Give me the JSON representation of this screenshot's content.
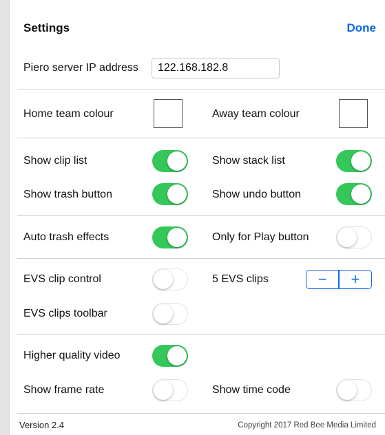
{
  "header": {
    "title": "Settings",
    "done_label": "Done"
  },
  "server": {
    "label": "Piero server IP address",
    "ip_value": "122.168.182.8"
  },
  "colours": {
    "home_label": "Home team colour",
    "away_label": "Away team colour",
    "home_colour": "#ffffff",
    "away_colour": "#ffffff"
  },
  "toggles": {
    "show_clip_list": {
      "label": "Show clip list",
      "on": true
    },
    "show_stack_list": {
      "label": "Show stack list",
      "on": true
    },
    "show_trash_button": {
      "label": "Show trash button",
      "on": true
    },
    "show_undo_button": {
      "label": "Show undo button",
      "on": true
    },
    "auto_trash_effects": {
      "label": "Auto trash effects",
      "on": true
    },
    "only_for_play_button": {
      "label": "Only for Play button",
      "on": false
    },
    "evs_clip_control": {
      "label": "EVS clip control",
      "on": false
    },
    "evs_clips_toolbar": {
      "label": "EVS clips toolbar",
      "on": false
    },
    "higher_quality_video": {
      "label": "Higher quality video",
      "on": true
    },
    "show_frame_rate": {
      "label": "Show frame rate",
      "on": false
    },
    "show_time_code": {
      "label": "Show time code",
      "on": false
    }
  },
  "evs": {
    "clips_label": "5 EVS clips",
    "minus_glyph": "−",
    "plus_glyph": "+"
  },
  "footer": {
    "version": "Version 2.4",
    "copyright": "Copyright 2017 Red Bee Media Limited"
  },
  "colors": {
    "accent": "#0a6be0",
    "toggle_on": "#34c759"
  }
}
